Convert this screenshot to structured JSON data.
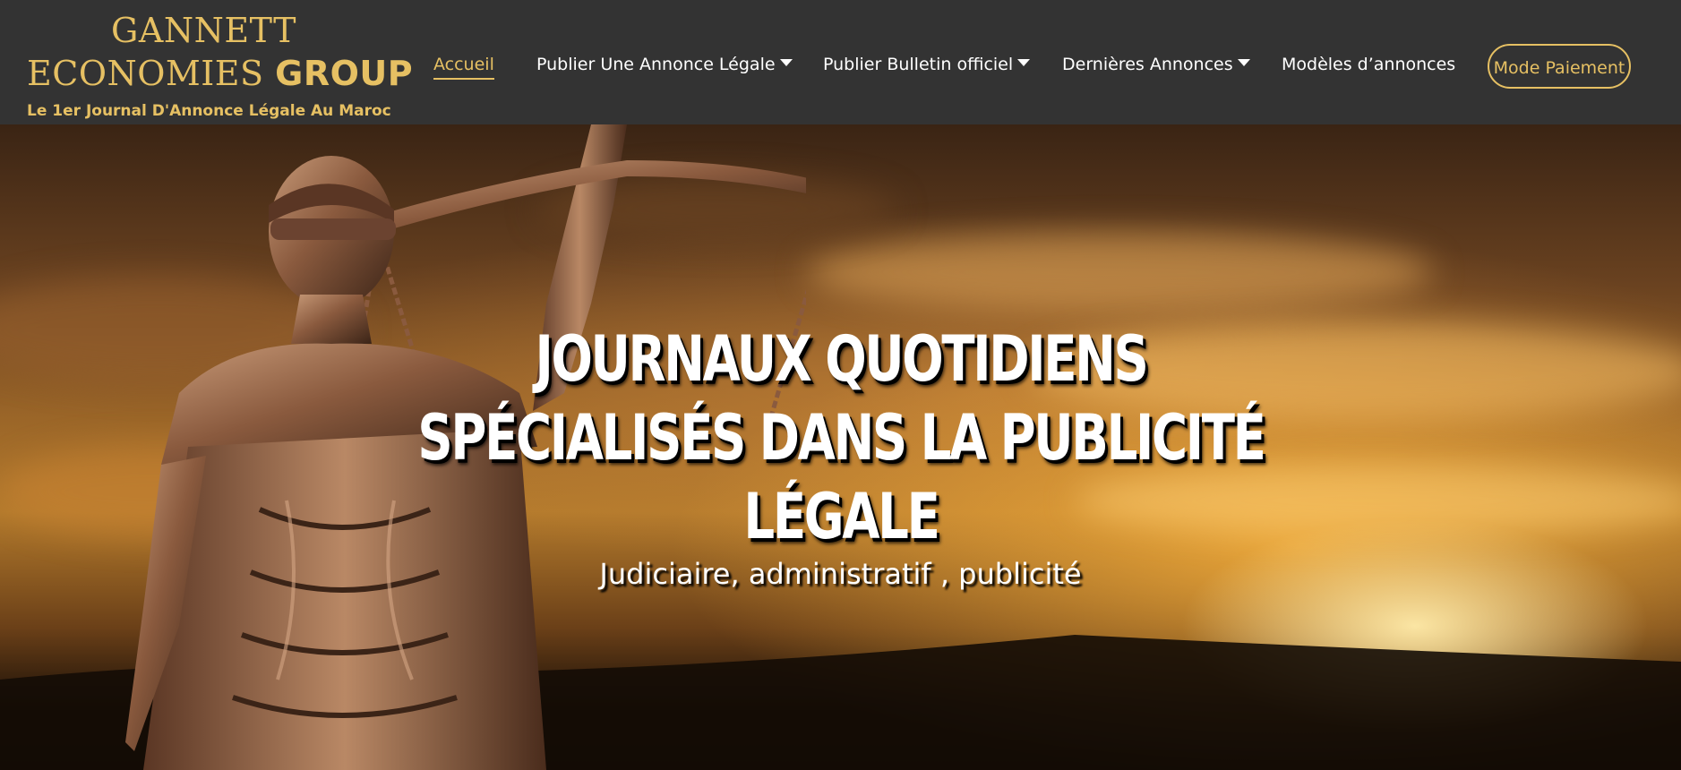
{
  "brand": {
    "line1": "GANNETT",
    "line2_regular": "ECONOMIES ",
    "line2_bold": "GROUP",
    "tagline": "Le 1er Journal D'Annonce Légale Au Maroc"
  },
  "nav": {
    "items": [
      {
        "label": "Accueil",
        "active": true,
        "dropdown": false
      },
      {
        "label": "Publier Une Annonce Légale",
        "active": false,
        "dropdown": true
      },
      {
        "label": "Publier Bulletin officiel",
        "active": false,
        "dropdown": true
      },
      {
        "label": "Dernières Annonces",
        "active": false,
        "dropdown": true
      },
      {
        "label": "Modèles d’annonces",
        "active": false,
        "dropdown": false
      }
    ],
    "cta_label": "Mode Paiement"
  },
  "hero": {
    "title": "JOURNAUX QUOTIDIENS SPÉCIALISÉS DANS LA PUBLICITÉ LÉGALE",
    "subtitle": "Judiciaire, administratif , publicité",
    "image": "lady-justice-statue-sunset"
  },
  "colors": {
    "navbar_bg": "#333333",
    "accent_gold": "#e6c063",
    "nav_text": "#ffffff"
  }
}
